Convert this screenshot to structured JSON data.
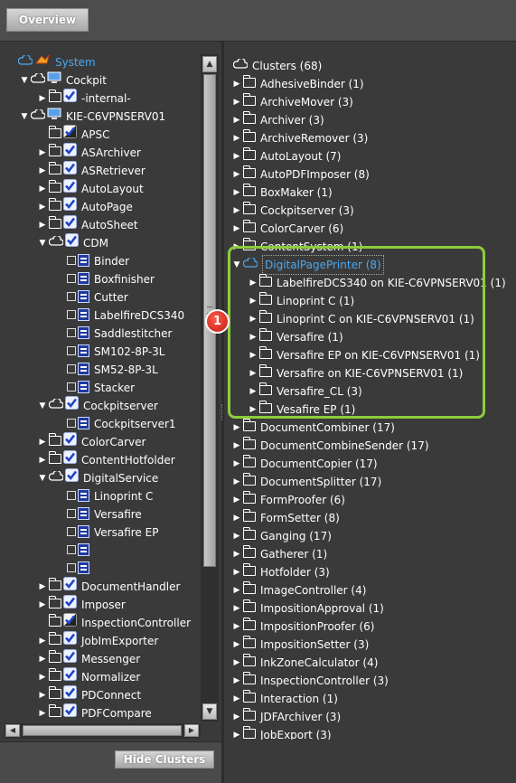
{
  "toolbar": {
    "overview_label": "Overview"
  },
  "left_tree": {
    "items": [
      {
        "label": "System",
        "level": 0,
        "toggle": "",
        "icon": "system-icon",
        "selected": false,
        "color": "#4aa8f0"
      },
      {
        "label": "Cockpit",
        "level": 1,
        "toggle": "▼",
        "icon": "computer-icon"
      },
      {
        "label": "-internal-",
        "level": 2,
        "toggle": "▶",
        "icon": "check-icon"
      },
      {
        "label": "KIE-C6VPNSERV01",
        "level": 1,
        "toggle": "▼",
        "icon": "computer-icon"
      },
      {
        "label": "APSC",
        "level": 2,
        "toggle": "",
        "icon": "warning-check-icon"
      },
      {
        "label": "ASArchiver",
        "level": 2,
        "toggle": "▶",
        "icon": "check-icon"
      },
      {
        "label": "ASRetriever",
        "level": 2,
        "toggle": "▶",
        "icon": "check-icon"
      },
      {
        "label": "AutoLayout",
        "level": 2,
        "toggle": "▶",
        "icon": "check-icon"
      },
      {
        "label": "AutoPage",
        "level": 2,
        "toggle": "▶",
        "icon": "check-icon"
      },
      {
        "label": "AutoSheet",
        "level": 2,
        "toggle": "▶",
        "icon": "check-icon"
      },
      {
        "label": "CDM",
        "level": 2,
        "toggle": "▼",
        "icon": "check-icon",
        "open": true
      },
      {
        "label": "Binder",
        "level": 3,
        "toggle": "",
        "icon": "device-icon"
      },
      {
        "label": "Boxfinisher",
        "level": 3,
        "toggle": "",
        "icon": "device-icon"
      },
      {
        "label": "Cutter",
        "level": 3,
        "toggle": "",
        "icon": "device-icon"
      },
      {
        "label": "LabelfireDCS340",
        "level": 3,
        "toggle": "",
        "icon": "device-icon"
      },
      {
        "label": "Saddlestitcher",
        "level": 3,
        "toggle": "",
        "icon": "device-icon"
      },
      {
        "label": "SM102-8P-3L",
        "level": 3,
        "toggle": "",
        "icon": "device-icon"
      },
      {
        "label": "SM52-8P-3L",
        "level": 3,
        "toggle": "",
        "icon": "device-icon"
      },
      {
        "label": "Stacker",
        "level": 3,
        "toggle": "",
        "icon": "device-icon"
      },
      {
        "label": "Cockpitserver",
        "level": 2,
        "toggle": "▼",
        "icon": "check-icon",
        "open": true
      },
      {
        "label": "Cockpitserver1",
        "level": 3,
        "toggle": "",
        "icon": "device-icon"
      },
      {
        "label": "ColorCarver",
        "level": 2,
        "toggle": "▶",
        "icon": "check-icon"
      },
      {
        "label": "ContentHotfolder",
        "level": 2,
        "toggle": "▶",
        "icon": "check-icon"
      },
      {
        "label": "DigitalService",
        "level": 2,
        "toggle": "▼",
        "icon": "check-icon",
        "open": true
      },
      {
        "label": "Linoprint C",
        "level": 3,
        "toggle": "",
        "icon": "device-icon"
      },
      {
        "label": "Versafire",
        "level": 3,
        "toggle": "",
        "icon": "device-icon"
      },
      {
        "label": "Versafire EP",
        "level": 3,
        "toggle": "",
        "icon": "device-icon"
      },
      {
        "label": "",
        "level": 3,
        "toggle": "",
        "icon": "device-icon"
      },
      {
        "label": "",
        "level": 3,
        "toggle": "",
        "icon": "device-icon"
      },
      {
        "label": "DocumentHandler",
        "level": 2,
        "toggle": "▶",
        "icon": "check-icon"
      },
      {
        "label": "Imposer",
        "level": 2,
        "toggle": "▶",
        "icon": "check-icon"
      },
      {
        "label": "InspectionController",
        "level": 2,
        "toggle": "",
        "icon": "warning-check-icon"
      },
      {
        "label": "JobImExporter",
        "level": 2,
        "toggle": "▶",
        "icon": "check-icon"
      },
      {
        "label": "Messenger",
        "level": 2,
        "toggle": "▶",
        "icon": "check-icon"
      },
      {
        "label": "Normalizer",
        "level": 2,
        "toggle": "▶",
        "icon": "check-icon"
      },
      {
        "label": "PDConnect",
        "level": 2,
        "toggle": "▶",
        "icon": "check-icon"
      },
      {
        "label": "PDFCompare",
        "level": 2,
        "toggle": "▶",
        "icon": "check-icon"
      }
    ]
  },
  "right_tree": {
    "root_label": "Clusters (68)",
    "items": [
      {
        "label": "AdhesiveBinder (1)",
        "level": 1,
        "toggle": "▶"
      },
      {
        "label": "ArchiveMover (3)",
        "level": 1,
        "toggle": "▶"
      },
      {
        "label": "Archiver (3)",
        "level": 1,
        "toggle": "▶"
      },
      {
        "label": "ArchiveRemover (3)",
        "level": 1,
        "toggle": "▶"
      },
      {
        "label": "AutoLayout (7)",
        "level": 1,
        "toggle": "▶"
      },
      {
        "label": "AutoPDFImposer (8)",
        "level": 1,
        "toggle": "▶"
      },
      {
        "label": "BoxMaker (1)",
        "level": 1,
        "toggle": "▶"
      },
      {
        "label": "Cockpitserver (3)",
        "level": 1,
        "toggle": "▶"
      },
      {
        "label": "ColorCarver (6)",
        "level": 1,
        "toggle": "▶"
      },
      {
        "label": "ContentSystem (1)",
        "level": 1,
        "toggle": "▶"
      },
      {
        "label": "DigitalPagePrinter (8)",
        "level": 1,
        "toggle": "▼",
        "selected": true,
        "open": true
      },
      {
        "label": "LabelfireDCS340 on KIE-C6VPNSERV01 (1)",
        "level": 2,
        "toggle": "▶"
      },
      {
        "label": "Linoprint C (1)",
        "level": 2,
        "toggle": "▶"
      },
      {
        "label": "Linoprint C on KIE-C6VPNSERV01 (1)",
        "level": 2,
        "toggle": "▶"
      },
      {
        "label": "Versafire (1)",
        "level": 2,
        "toggle": "▶"
      },
      {
        "label": "Versafire EP on KIE-C6VPNSERV01 (1)",
        "level": 2,
        "toggle": "▶"
      },
      {
        "label": "Versafire on KIE-C6VPNSERV01 (1)",
        "level": 2,
        "toggle": "▶"
      },
      {
        "label": "Versafire_CL (3)",
        "level": 2,
        "toggle": "▶"
      },
      {
        "label": "Vesafire EP (1)",
        "level": 2,
        "toggle": "▶"
      },
      {
        "label": "DocumentCombiner (17)",
        "level": 1,
        "toggle": "▶"
      },
      {
        "label": "DocumentCombineSender (17)",
        "level": 1,
        "toggle": "▶"
      },
      {
        "label": "DocumentCopier (17)",
        "level": 1,
        "toggle": "▶"
      },
      {
        "label": "DocumentSplitter (17)",
        "level": 1,
        "toggle": "▶"
      },
      {
        "label": "FormProofer (6)",
        "level": 1,
        "toggle": "▶"
      },
      {
        "label": "FormSetter (8)",
        "level": 1,
        "toggle": "▶"
      },
      {
        "label": "Ganging (17)",
        "level": 1,
        "toggle": "▶"
      },
      {
        "label": "Gatherer (1)",
        "level": 1,
        "toggle": "▶"
      },
      {
        "label": "Hotfolder (3)",
        "level": 1,
        "toggle": "▶"
      },
      {
        "label": "ImageController (4)",
        "level": 1,
        "toggle": "▶"
      },
      {
        "label": "ImpositionApproval (1)",
        "level": 1,
        "toggle": "▶"
      },
      {
        "label": "ImpositionProofer (6)",
        "level": 1,
        "toggle": "▶"
      },
      {
        "label": "ImpositionSetter (3)",
        "level": 1,
        "toggle": "▶"
      },
      {
        "label": "InkZoneCalculator (4)",
        "level": 1,
        "toggle": "▶"
      },
      {
        "label": "InspectionController (3)",
        "level": 1,
        "toggle": "▶"
      },
      {
        "label": "Interaction (1)",
        "level": 1,
        "toggle": "▶"
      },
      {
        "label": "JDFArchiver (3)",
        "level": 1,
        "toggle": "▶"
      },
      {
        "label": "JobExport (3)",
        "level": 1,
        "toggle": "▶"
      }
    ]
  },
  "bottom": {
    "hide_clusters_label": "Hide Clusters"
  },
  "callout": {
    "number": "1"
  },
  "colors": {
    "highlight": "#8ccc3c",
    "selection": "#4aa8f0",
    "callout": "#d42418"
  }
}
